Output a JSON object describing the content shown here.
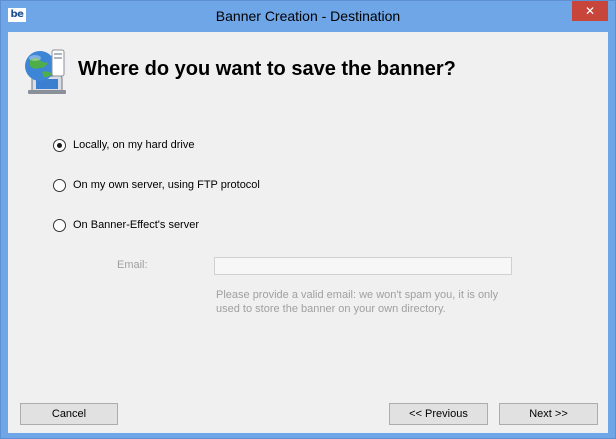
{
  "window": {
    "title": "Banner Creation - Destination",
    "app_icon_text": "be",
    "close_glyph": "✕"
  },
  "header": {
    "title": "Where do you want to save the banner?",
    "icon": "globe-computer-icon"
  },
  "options": [
    {
      "label": "Locally, on my hard drive",
      "checked": true
    },
    {
      "label": "On my own server, using FTP protocol",
      "checked": false
    },
    {
      "label": "On Banner-Effect's server",
      "checked": false
    }
  ],
  "email": {
    "label": "Email:",
    "value": "",
    "help": "Please provide a valid email: we won't spam you, it is only used to store the banner on your own directory."
  },
  "buttons": {
    "cancel": "Cancel",
    "previous": "<< Previous",
    "next": "Next >>"
  }
}
